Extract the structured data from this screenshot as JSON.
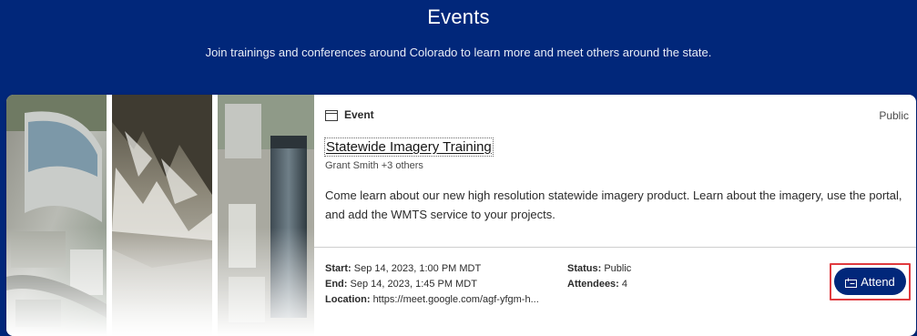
{
  "header": {
    "title": "Events",
    "subtitle": "Join trainings and conferences around Colorado to learn more and meet others around the state."
  },
  "card": {
    "type_label": "Event",
    "access": "Public",
    "title": "Statewide Imagery Training",
    "organizers": "Grant Smith +3 others",
    "description": "Come learn about our new high resolution statewide imagery product. Learn about the imagery, use the portal, and add the WMTS service to your projects.",
    "details": {
      "start_label": "Start:",
      "start_value": "Sep 14, 2023, 1:00 PM MDT",
      "end_label": "End:",
      "end_value": "Sep 14, 2023, 1:45 PM MDT",
      "location_label": "Location:",
      "location_value": "https://meet.google.com/agf-yfgm-h...",
      "status_label": "Status:",
      "status_value": "Public",
      "attendees_label": "Attendees:",
      "attendees_value": "4"
    },
    "attend_label": "Attend"
  },
  "colors": {
    "brand_navy": "#01277a",
    "highlight_red": "#e03a3e"
  }
}
